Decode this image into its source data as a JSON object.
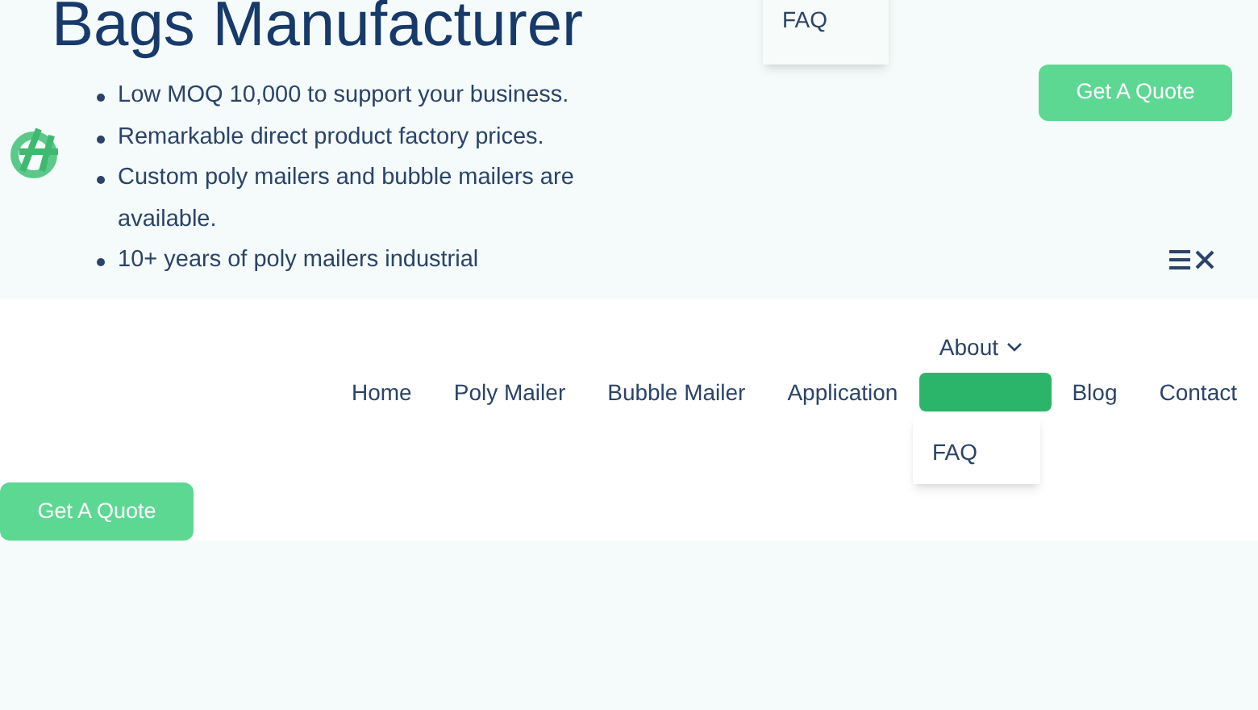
{
  "hero": {
    "heading": "Bags Manufacturer",
    "bullets": [
      "Low MOQ 10,000 to support your business.",
      "Remarkable direct product factory prices.",
      "Custom poly mailers and bubble mailers are available.",
      "10+ years of poly mailers industrial"
    ],
    "dropdown": {
      "items": [
        "FAQ"
      ]
    },
    "quote_button": "Get A Quote"
  },
  "nav": {
    "about": "About",
    "items": [
      {
        "kind": "link",
        "label": "Home",
        "selected": false
      },
      {
        "kind": "link",
        "label": "Poly Mailer",
        "selected": false
      },
      {
        "kind": "link",
        "label": "Bubble Mailer",
        "selected": false
      },
      {
        "kind": "link",
        "label": "Application",
        "selected": false
      },
      {
        "kind": "blank",
        "selected": true
      },
      {
        "kind": "link",
        "label": "Blog",
        "selected": false
      },
      {
        "kind": "link",
        "label": "Contact",
        "selected": false
      }
    ],
    "dropdown": {
      "items": [
        "FAQ"
      ]
    },
    "quote_button": "Get A Quote"
  }
}
